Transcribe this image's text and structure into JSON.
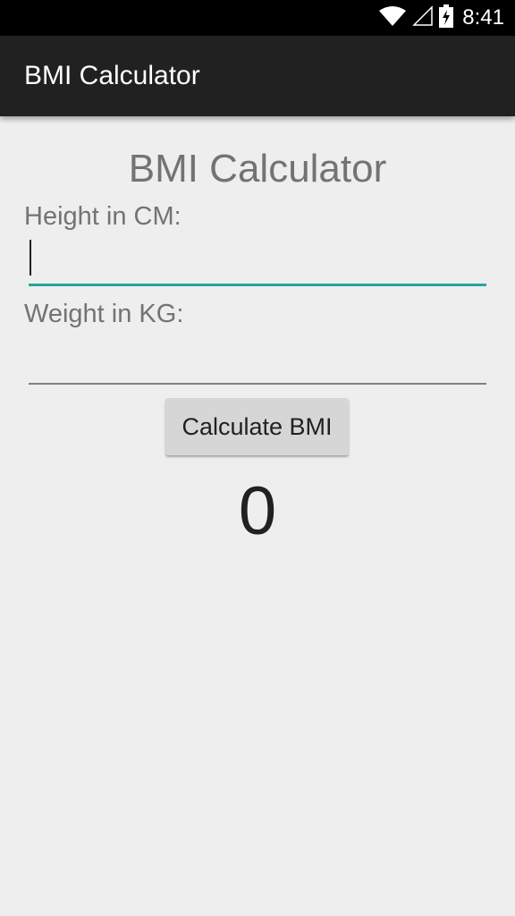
{
  "status_bar": {
    "time": "8:41",
    "icons": [
      "wifi-icon",
      "signal-icon",
      "battery-charging-icon"
    ]
  },
  "app_bar": {
    "title": "BMI Calculator"
  },
  "form": {
    "heading": "BMI Calculator",
    "height_label": "Height in CM:",
    "height_value": "",
    "weight_label": "Weight in KG:",
    "weight_value": "",
    "calculate_label": "Calculate BMI",
    "result": "0"
  },
  "colors": {
    "status_bar": "#000000",
    "app_bar": "#212121",
    "background": "#eeeeee",
    "accent": "#26a69a",
    "button": "#d6d6d6"
  }
}
